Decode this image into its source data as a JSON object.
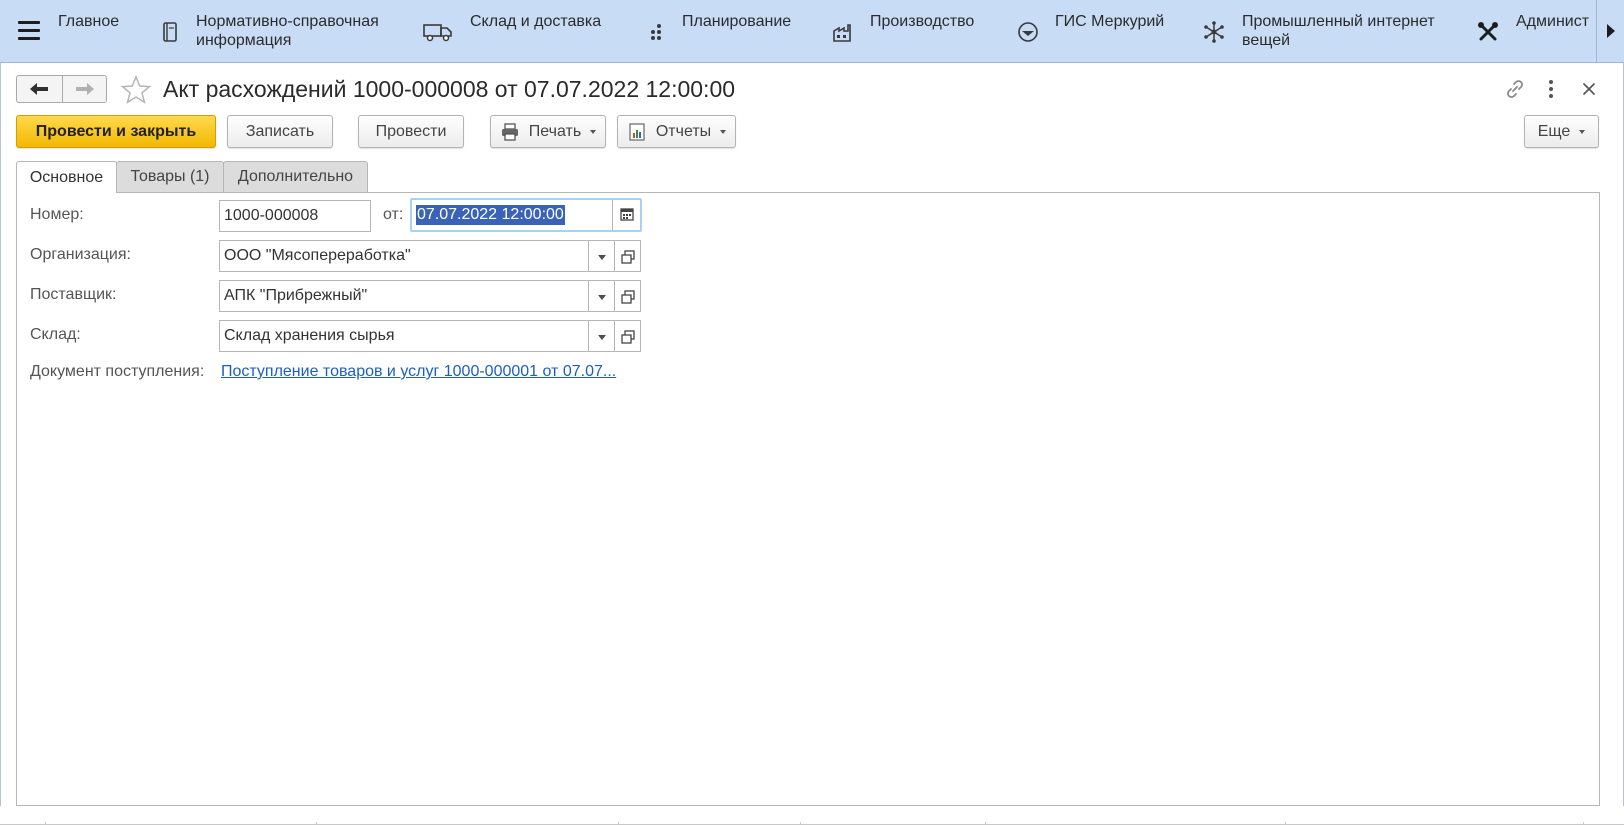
{
  "top_sections": {
    "menu_icon": "hamburger-icon",
    "items": [
      {
        "label": "Главное",
        "icon": "none"
      },
      {
        "label": "Нормативно-справочная информация",
        "icon": "reference-book-icon"
      },
      {
        "label": "Склад и доставка",
        "icon": "delivery-truck-icon"
      },
      {
        "label": "Планирование",
        "icon": "planning-dots-icon"
      },
      {
        "label": "Производство",
        "icon": "factory-icon"
      },
      {
        "label": "ГИС Меркурий",
        "icon": "mercury-icon"
      },
      {
        "label": "Промышленный интернет вещей",
        "icon": "iot-network-icon"
      },
      {
        "label": "Админист",
        "icon": "tools-icon"
      }
    ],
    "scroll_icon": "scroll-right-arrow-icon"
  },
  "window": {
    "title": "Акт расхождений 1000-000008 от 07.07.2022 12:00:00",
    "back_icon": "arrow-left-icon",
    "forward_icon": "arrow-right-icon",
    "favorite_icon": "star-icon",
    "link_icon": "link-icon",
    "more_icon": "more-vertical-icon",
    "close_icon": "close-icon"
  },
  "toolbar": {
    "post_and_close": "Провести и закрыть",
    "save": "Записать",
    "post": "Провести",
    "print": "Печать",
    "reports": "Отчеты",
    "more": "Еще"
  },
  "tabs": [
    {
      "label": "Основное",
      "active": true
    },
    {
      "label": "Товары (1)",
      "active": false
    },
    {
      "label": "Дополнительно",
      "active": false
    }
  ],
  "form": {
    "number_label": "Номер:",
    "number_value": "1000-000008",
    "date_label": "от:",
    "date_value": "07.07.2022 12:00:00",
    "organization_label": "Организация:",
    "organization_value": "ООО \"Мясопереработка\"",
    "supplier_label": "Поставщик:",
    "supplier_value": "АПК \"Прибрежный\"",
    "warehouse_label": "Склад:",
    "warehouse_value": "Склад хранения сырья",
    "receipt_doc_label": "Документ поступления:",
    "receipt_doc_link": "Поступление товаров и услуг 1000-000001 от 07.07..."
  },
  "colors": {
    "section_bar": "#c9dcf5",
    "primary_button": "#f2b800",
    "link": "#1b5ec6",
    "selection": "#3a63b8",
    "focus_border": "#a7d3f0"
  }
}
